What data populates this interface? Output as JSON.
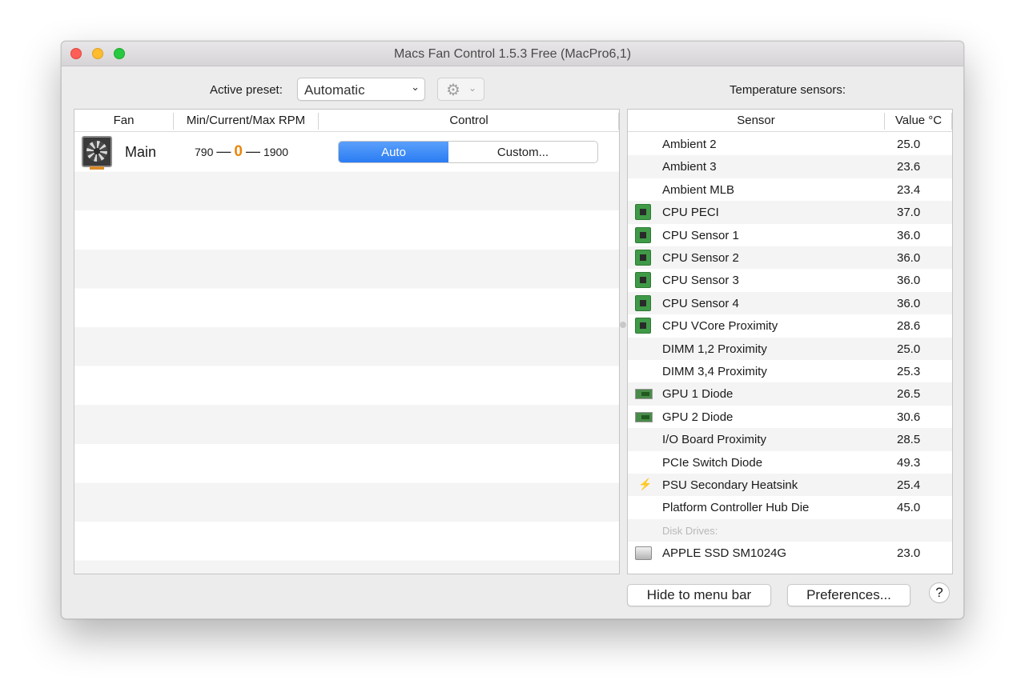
{
  "window": {
    "title": "Macs Fan Control 1.5.3 Free (MacPro6,1)"
  },
  "toolbar": {
    "preset_label": "Active preset:",
    "preset_value": "Automatic",
    "gear_icon": "gear-icon",
    "sensors_title": "Temperature sensors:"
  },
  "fans": {
    "columns": [
      "Fan",
      "Min/Current/Max RPM",
      "Control"
    ],
    "rows": [
      {
        "name": "Main",
        "min": "790",
        "current": "0",
        "max": "1900",
        "auto_label": "Auto",
        "custom_label": "Custom...",
        "mode": "Auto"
      }
    ],
    "current_color": "#e8870b"
  },
  "sensors": {
    "columns": [
      "Sensor",
      "Value °C"
    ],
    "rows": [
      {
        "name": "Ambient 2",
        "value": "25.0",
        "icon": ""
      },
      {
        "name": "Ambient 3",
        "value": "23.6",
        "icon": ""
      },
      {
        "name": "Ambient MLB",
        "value": "23.4",
        "icon": ""
      },
      {
        "name": "CPU PECI",
        "value": "37.0",
        "icon": "cpu-chip-icon"
      },
      {
        "name": "CPU Sensor 1",
        "value": "36.0",
        "icon": "cpu-chip-icon"
      },
      {
        "name": "CPU Sensor 2",
        "value": "36.0",
        "icon": "cpu-chip-icon"
      },
      {
        "name": "CPU Sensor 3",
        "value": "36.0",
        "icon": "cpu-chip-icon"
      },
      {
        "name": "CPU Sensor 4",
        "value": "36.0",
        "icon": "cpu-chip-icon"
      },
      {
        "name": "CPU VCore Proximity",
        "value": "28.6",
        "icon": "cpu-chip-icon"
      },
      {
        "name": "DIMM 1,2 Proximity",
        "value": "25.0",
        "icon": ""
      },
      {
        "name": "DIMM 3,4 Proximity",
        "value": "25.3",
        "icon": ""
      },
      {
        "name": "GPU 1 Diode",
        "value": "26.5",
        "icon": "gpu-card-icon"
      },
      {
        "name": "GPU 2 Diode",
        "value": "30.6",
        "icon": "gpu-card-icon"
      },
      {
        "name": "I/O Board Proximity",
        "value": "28.5",
        "icon": ""
      },
      {
        "name": "PCIe Switch Diode",
        "value": "49.3",
        "icon": ""
      },
      {
        "name": "PSU Secondary Heatsink",
        "value": "25.4",
        "icon": "lightning-icon"
      },
      {
        "name": "Platform Controller Hub Die",
        "value": "45.0",
        "icon": ""
      },
      {
        "name": "Disk Drives:",
        "value": "",
        "icon": "",
        "group": true
      },
      {
        "name": "APPLE SSD SM1024G",
        "value": "23.0",
        "icon": "hard-disk-icon"
      }
    ]
  },
  "footer": {
    "hide_label": "Hide to menu bar",
    "prefs_label": "Preferences...",
    "help_label": "?"
  }
}
